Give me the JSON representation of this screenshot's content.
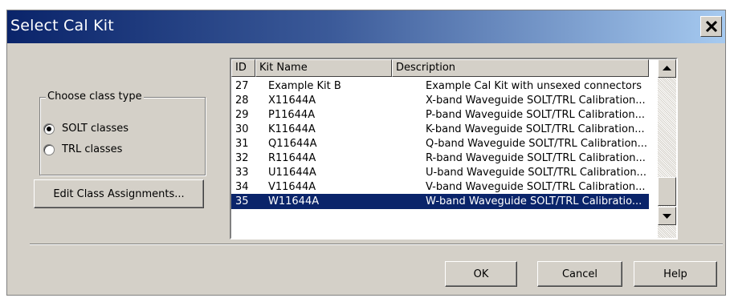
{
  "window": {
    "title": "Select Cal Kit"
  },
  "class_group": {
    "legend": "Choose class type",
    "options": [
      {
        "label": "SOLT classes",
        "selected": true
      },
      {
        "label": "TRL classes",
        "selected": false
      }
    ]
  },
  "buttons": {
    "edit_class": "Edit Class Assignments...",
    "ok": "OK",
    "cancel": "Cancel",
    "help": "Help"
  },
  "kit_list": {
    "columns": [
      "ID",
      "Kit Name",
      "Description"
    ],
    "rows": [
      {
        "id": "27",
        "name": "Example Kit B",
        "description": "Example Cal Kit with unsexed connectors"
      },
      {
        "id": "28",
        "name": "X11644A",
        "description": "X-band Waveguide SOLT/TRL Calibration..."
      },
      {
        "id": "29",
        "name": "P11644A",
        "description": "P-band Waveguide SOLT/TRL Calibration..."
      },
      {
        "id": "30",
        "name": "K11644A",
        "description": "K-band Waveguide SOLT/TRL Calibration..."
      },
      {
        "id": "31",
        "name": "Q11644A",
        "description": "Q-band Waveguide SOLT/TRL Calibration..."
      },
      {
        "id": "32",
        "name": "R11644A",
        "description": "R-band Waveguide SOLT/TRL Calibration..."
      },
      {
        "id": "33",
        "name": "U11644A",
        "description": "U-band Waveguide SOLT/TRL Calibration..."
      },
      {
        "id": "34",
        "name": "V11644A",
        "description": "V-band Waveguide SOLT/TRL Calibration..."
      },
      {
        "id": "35",
        "name": "W11644A",
        "description": "W-band Waveguide SOLT/TRL Calibratio..."
      }
    ],
    "selected_id": "35"
  },
  "icons": {
    "close": "close-icon",
    "scroll_up": "arrow-up-icon",
    "scroll_down": "arrow-down-icon"
  },
  "colors": {
    "titlebar_start": "#0a246a",
    "titlebar_end": "#a6caf0",
    "selection": "#0a246a",
    "face": "#d4d0c8"
  }
}
